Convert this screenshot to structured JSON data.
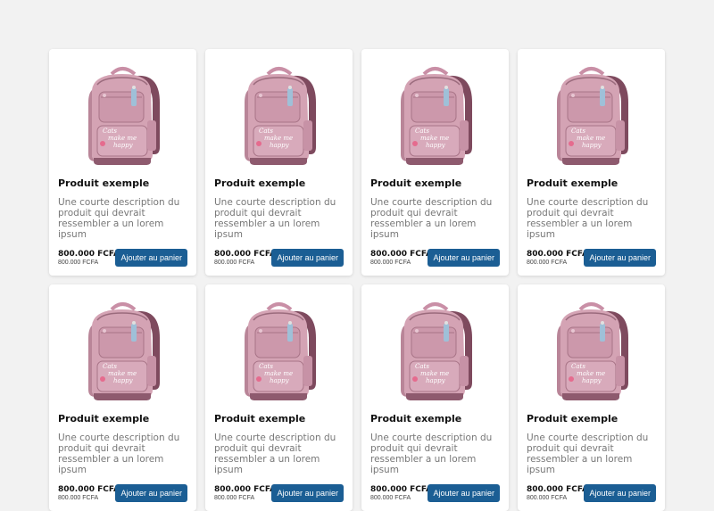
{
  "products": [
    {
      "title": "Produit exemple",
      "description": "Une courte description du produit qui devrait ressembler a un lorem ipsum",
      "price": "800.000 FCFA",
      "price_old": "800.000 FCFA",
      "button": "Ajouter au panier",
      "image_text": "Cats make me happy"
    },
    {
      "title": "Produit exemple",
      "description": "Une courte description du produit qui devrait ressembler a un lorem ipsum",
      "price": "800.000 FCFA",
      "price_old": "800.000 FCFA",
      "button": "Ajouter au panier",
      "image_text": "Cats make me happy"
    },
    {
      "title": "Produit exemple",
      "description": "Une courte description du produit qui devrait ressembler a un lorem ipsum",
      "price": "800.000 FCFA",
      "price_old": "800.000 FCFA",
      "button": "Ajouter au panier",
      "image_text": "Cats make me happy"
    },
    {
      "title": "Produit exemple",
      "description": "Une courte description du produit qui devrait ressembler a un lorem ipsum",
      "price": "800.000 FCFA",
      "price_old": "800.000 FCFA",
      "button": "Ajouter au panier",
      "image_text": "Cats make me happy"
    },
    {
      "title": "Produit exemple",
      "description": "Une courte description du produit qui devrait ressembler a un lorem ipsum",
      "price": "800.000 FCFA",
      "price_old": "800.000 FCFA",
      "button": "Ajouter au panier",
      "image_text": "Cats make me happy"
    },
    {
      "title": "Produit exemple",
      "description": "Une courte description du produit qui devrait ressembler a un lorem ipsum",
      "price": "800.000 FCFA",
      "price_old": "800.000 FCFA",
      "button": "Ajouter au panier",
      "image_text": "Cats make me happy"
    },
    {
      "title": "Produit exemple",
      "description": "Une courte description du produit qui devrait ressembler a un lorem ipsum",
      "price": "800.000 FCFA",
      "price_old": "800.000 FCFA",
      "button": "Ajouter au panier",
      "image_text": "Cats make me happy"
    },
    {
      "title": "Produit exemple",
      "description": "Une courte description du produit qui devrait ressembler a un lorem ipsum",
      "price": "800.000 FCFA",
      "price_old": "800.000 FCFA",
      "button": "Ajouter au panier",
      "image_text": "Cats make me happy"
    }
  ],
  "colors": {
    "page_background": "#f2f2f2",
    "button": "#1b5e94",
    "backpack": "#d4a3b4"
  }
}
